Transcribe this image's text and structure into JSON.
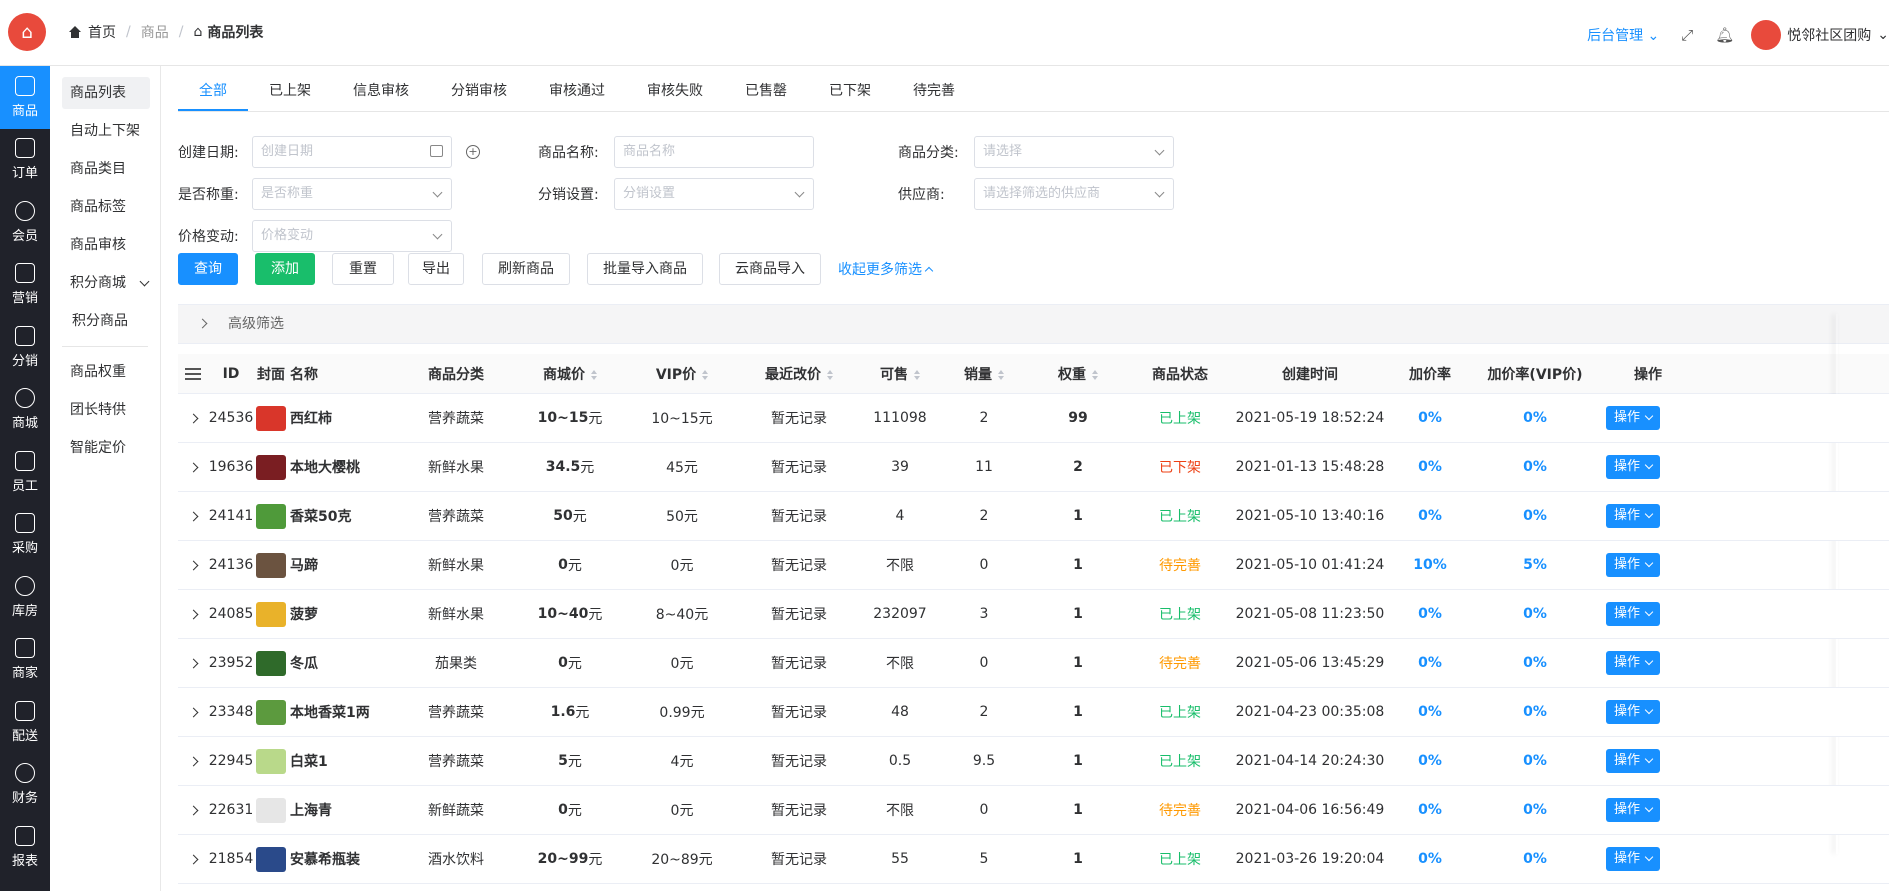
{
  "app": {
    "brand_logo": "house-logo",
    "shop_name": "悦邻社区团购"
  },
  "breadcrumb": {
    "home": "首页",
    "section": "商品",
    "current": "商品列表"
  },
  "header": {
    "mgmt_label": "后台管理"
  },
  "leftnav": [
    {
      "label": "商品",
      "icon": "bag-icon"
    },
    {
      "label": "订单",
      "icon": "document-icon"
    },
    {
      "label": "会员",
      "icon": "user-icon"
    },
    {
      "label": "营销",
      "icon": "gift-icon"
    },
    {
      "label": "分销",
      "icon": "share-icon"
    },
    {
      "label": "商城",
      "icon": "store-icon"
    },
    {
      "label": "员工",
      "icon": "staff-icon"
    },
    {
      "label": "采购",
      "icon": "clipboard-icon"
    },
    {
      "label": "库房",
      "icon": "warehouse-icon"
    },
    {
      "label": "商家",
      "icon": "shop-icon"
    },
    {
      "label": "配送",
      "icon": "truck-icon"
    },
    {
      "label": "财务",
      "icon": "yen-icon"
    },
    {
      "label": "报表",
      "icon": "chart-icon"
    }
  ],
  "subnav": {
    "items": [
      "商品列表",
      "自动上下架",
      "商品类目",
      "商品标签",
      "商品审核",
      "积分商城",
      "积分商品",
      "商品权重",
      "团长特供",
      "智能定价"
    ]
  },
  "tabs": [
    "全部",
    "已上架",
    "信息审核",
    "分销审核",
    "审核通过",
    "审核失败",
    "已售罄",
    "已下架",
    "待完善"
  ],
  "filters": {
    "create_date": {
      "label": "创建日期:",
      "placeholder": "创建日期"
    },
    "goods_name": {
      "label": "商品名称:",
      "placeholder": "商品名称"
    },
    "category": {
      "label": "商品分类:",
      "placeholder": "请选择"
    },
    "weigh": {
      "label": "是否称重:",
      "placeholder": "是否称重"
    },
    "distribution": {
      "label": "分销设置:",
      "placeholder": "分销设置"
    },
    "supplier": {
      "label": "供应商:",
      "placeholder": "请选择筛选的供应商"
    },
    "price_change": {
      "label": "价格变动:",
      "placeholder": "价格变动"
    }
  },
  "actions": {
    "query": "查询",
    "add": "添加",
    "reset": "重置",
    "export": "导出",
    "refresh": "刷新商品",
    "batch_import": "批量导入商品",
    "cloud_import": "云商品导入",
    "collapse": "收起更多筛选"
  },
  "advanced": {
    "label": "高级筛选"
  },
  "table": {
    "headers": {
      "id": "ID",
      "cover": "封面",
      "name": "名称",
      "category": "商品分类",
      "price": "商城价",
      "vip": "VIP价",
      "last_change": "最近改价",
      "avail": "可售",
      "sales": "销量",
      "weight": "权重",
      "status": "商品状态",
      "created": "创建时间",
      "markup": "加价率",
      "markup_vip": "加价率(VIP价)",
      "op": "操作"
    },
    "op_label": "操作",
    "rows": [
      {
        "id": "24536",
        "thumb": "#d9362a",
        "name": "西红柿",
        "category": "营养蔬菜",
        "price": "10~15",
        "unit": "元",
        "vip": "10~15元",
        "last_change": "暂无记录",
        "avail": "111098",
        "sales": "2",
        "weight": "99",
        "status": "已上架",
        "status_type": "on",
        "created": "2021-05-19 18:52:24",
        "markup": "0%",
        "markup_vip": "0%"
      },
      {
        "id": "19636",
        "thumb": "#7a1e22",
        "name": "本地大樱桃",
        "category": "新鲜水果",
        "price": "34.5",
        "unit": "元",
        "vip": "45元",
        "last_change": "暂无记录",
        "avail": "39",
        "sales": "11",
        "weight": "2",
        "status": "已下架",
        "status_type": "off",
        "created": "2021-01-13 15:48:28",
        "markup": "0%",
        "markup_vip": "0%"
      },
      {
        "id": "24141",
        "thumb": "#4f9a3a",
        "name": "香菜50克",
        "category": "营养蔬菜",
        "price": "50",
        "unit": "元",
        "vip": "50元",
        "last_change": "暂无记录",
        "avail": "4",
        "sales": "2",
        "weight": "1",
        "status": "已上架",
        "status_type": "on",
        "created": "2021-05-10 13:40:16",
        "markup": "0%",
        "markup_vip": "0%"
      },
      {
        "id": "24136",
        "thumb": "#6b5340",
        "name": "马蹄",
        "category": "新鲜水果",
        "price": "0",
        "unit": "元",
        "vip": "0元",
        "last_change": "暂无记录",
        "avail": "不限",
        "sales": "0",
        "weight": "1",
        "status": "待完善",
        "status_type": "pend",
        "created": "2021-05-10 01:41:24",
        "markup": "10%",
        "markup_vip": "5%"
      },
      {
        "id": "24085",
        "thumb": "#e9b22a",
        "name": "菠萝",
        "category": "新鲜水果",
        "price": "10~40",
        "unit": "元",
        "vip": "8~40元",
        "last_change": "暂无记录",
        "avail": "232097",
        "sales": "3",
        "weight": "1",
        "status": "已上架",
        "status_type": "on",
        "created": "2021-05-08 11:23:50",
        "markup": "0%",
        "markup_vip": "0%"
      },
      {
        "id": "23952",
        "thumb": "#2f6a2a",
        "name": "冬瓜",
        "category": "茄果类",
        "price": "0",
        "unit": "元",
        "vip": "0元",
        "last_change": "暂无记录",
        "avail": "不限",
        "sales": "0",
        "weight": "1",
        "status": "待完善",
        "status_type": "pend",
        "created": "2021-05-06 13:45:29",
        "markup": "0%",
        "markup_vip": "0%"
      },
      {
        "id": "23348",
        "thumb": "#5c9a3e",
        "name": "本地香菜1两",
        "category": "营养蔬菜",
        "price": "1.6",
        "unit": "元",
        "vip": "0.99元",
        "last_change": "暂无记录",
        "avail": "48",
        "sales": "2",
        "weight": "1",
        "status": "已上架",
        "status_type": "on",
        "created": "2021-04-23 00:35:08",
        "markup": "0%",
        "markup_vip": "0%"
      },
      {
        "id": "22945",
        "thumb": "#b9d98a",
        "name": "白菜1",
        "category": "营养蔬菜",
        "price": "5",
        "unit": "元",
        "vip": "4元",
        "last_change": "暂无记录",
        "avail": "0.5",
        "sales": "9.5",
        "weight": "1",
        "status": "已上架",
        "status_type": "on",
        "created": "2021-04-14 20:24:30",
        "markup": "0%",
        "markup_vip": "0%"
      },
      {
        "id": "22631",
        "thumb": "#e6e6e6",
        "name": "上海青",
        "category": "新鲜蔬菜",
        "price": "0",
        "unit": "元",
        "vip": "0元",
        "last_change": "暂无记录",
        "avail": "不限",
        "sales": "0",
        "weight": "1",
        "status": "待完善",
        "status_type": "pend",
        "created": "2021-04-06 16:56:49",
        "markup": "0%",
        "markup_vip": "0%"
      },
      {
        "id": "21854",
        "thumb": "#2a4a8a",
        "name": "安慕希瓶装",
        "category": "酒水饮料",
        "price": "20~99",
        "unit": "元",
        "vip": "20~89元",
        "last_change": "暂无记录",
        "avail": "55",
        "sales": "5",
        "weight": "1",
        "status": "已上架",
        "status_type": "on",
        "created": "2021-03-26 19:20:04",
        "markup": "0%",
        "markup_vip": "0%"
      }
    ]
  }
}
